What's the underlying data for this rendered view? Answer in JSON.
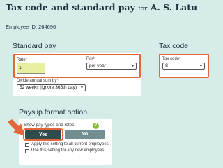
{
  "header": {
    "title": "Tax code and standard pay",
    "for_word": "for",
    "employee_name": "A. S. Latu",
    "employee_id": "Employee ID: 264696"
  },
  "standard_pay": {
    "heading": "Standard pay",
    "rate_label": "Rate",
    "rate_value": "1",
    "per_label": "Per",
    "per_value": "per year",
    "divide_label": "Divide annual sum by",
    "divide_value": "52 weeks (ignore 365th day)",
    "required_mark": "*"
  },
  "tax_code": {
    "heading": "Tax code",
    "label": "Tax code",
    "value": "S",
    "required_mark": "*"
  },
  "payslip": {
    "heading": "Payslip format option",
    "question": "Show pay types and rates",
    "help_glyph": "?",
    "yes_label": "Yes",
    "no_label": "No",
    "apply_all": "Apply this setting to all current employees",
    "use_new": "Use this setting for any new employees"
  },
  "colors": {
    "background": "#d5ece9",
    "highlight": "#e4673b",
    "yes_button": "#2f4d4c",
    "no_button": "#718f90",
    "rate_field": "#e8f0a0"
  }
}
